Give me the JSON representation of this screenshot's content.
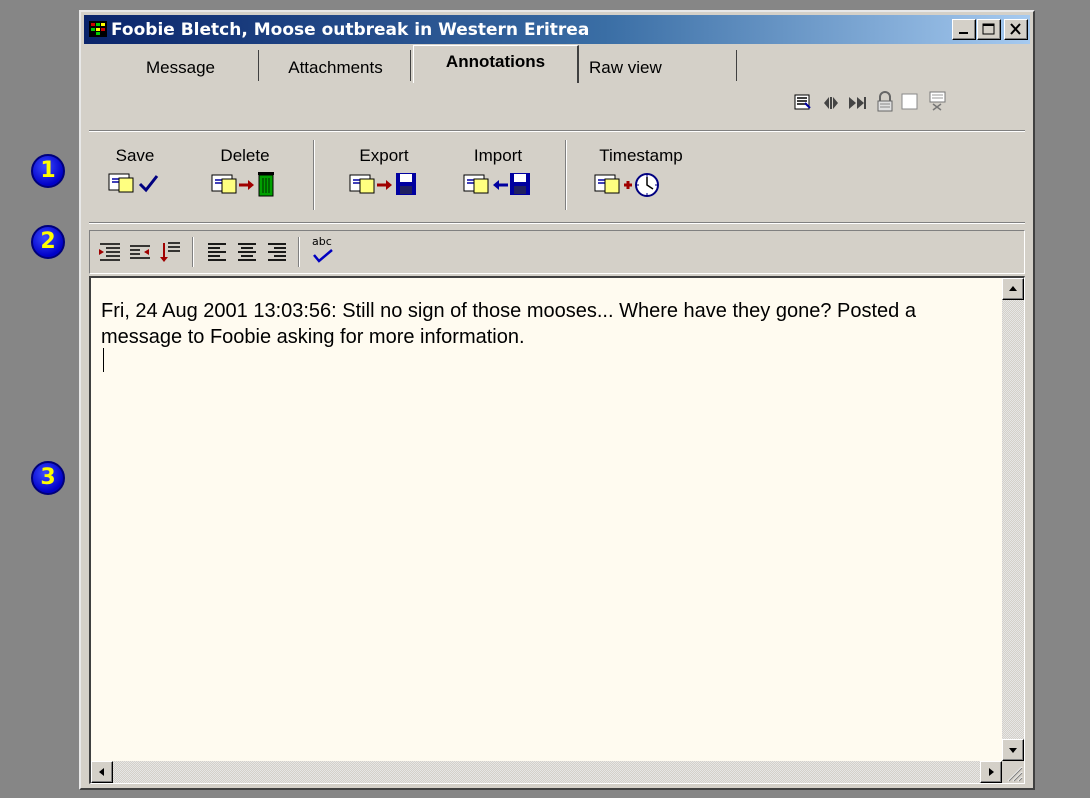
{
  "window": {
    "title": "Foobie Bletch, Moose outbreak in Western Eritrea"
  },
  "title_buttons": [
    "minimize-icon",
    "maximize-icon",
    "close-icon"
  ],
  "tabs": [
    {
      "label": "Message",
      "active": false
    },
    {
      "label": "Attachments",
      "active": false
    },
    {
      "label": "Annotations",
      "active": true
    },
    {
      "label": "Raw view",
      "active": false
    }
  ],
  "tab_icons": [
    "headers-icon",
    "prev-next-icon",
    "fast-forward-icon",
    "lock-icon",
    "checkbox-icon",
    "spam-icon"
  ],
  "toolbar": {
    "save": "Save",
    "delete": "Delete",
    "export": "Export",
    "import": "Import",
    "timestamp": "Timestamp"
  },
  "format_toolbar": [
    "indent-icon",
    "outdent-icon",
    "bullet-icon",
    "align-left-icon",
    "align-center-icon",
    "align-right-icon",
    "spellcheck-icon"
  ],
  "spell_label": "abc",
  "annotation_text": "Fri, 24 Aug 2001 13:03:56: Still no sign of those mooses... Where have they gone? Posted a message to Foobie asking for more information.",
  "callouts": [
    "1",
    "2",
    "3"
  ],
  "colors": {
    "title_start": "#0a246a",
    "title_end": "#a6caf0",
    "editor_bg": "#fffbf0",
    "callout_bg": "#0000c8",
    "callout_text": "#ffff00"
  }
}
